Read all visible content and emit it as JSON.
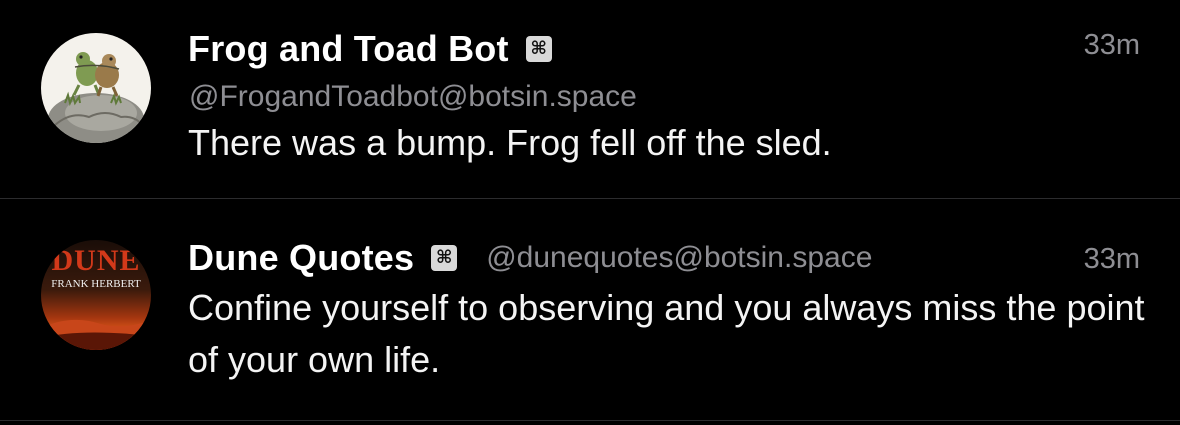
{
  "posts": [
    {
      "display_name": "Frog and Toad Bot",
      "badge_icon": "⌘",
      "handle": "@FrogandToadbot@botsin.space",
      "time": "33m",
      "content": "There was a bump. Frog fell off the sled.",
      "avatar_icon": "frog-and-toad-avatar"
    },
    {
      "display_name": "Dune Quotes",
      "badge_icon": "⌘",
      "handle": "@dunequotes@botsin.space",
      "time": "33m",
      "content": "Confine yourself to observing and you always miss the point of your own life.",
      "avatar_icon": "dune-book-cover-avatar",
      "avatar_text": {
        "title": "DUNE",
        "author": "FRANK HERBERT"
      }
    }
  ],
  "colors": {
    "background": "#000000",
    "text": "#f4f4f4",
    "secondary": "#8e8e93",
    "divider": "#2c2c2e",
    "badge_bg": "#d9d9d9"
  }
}
